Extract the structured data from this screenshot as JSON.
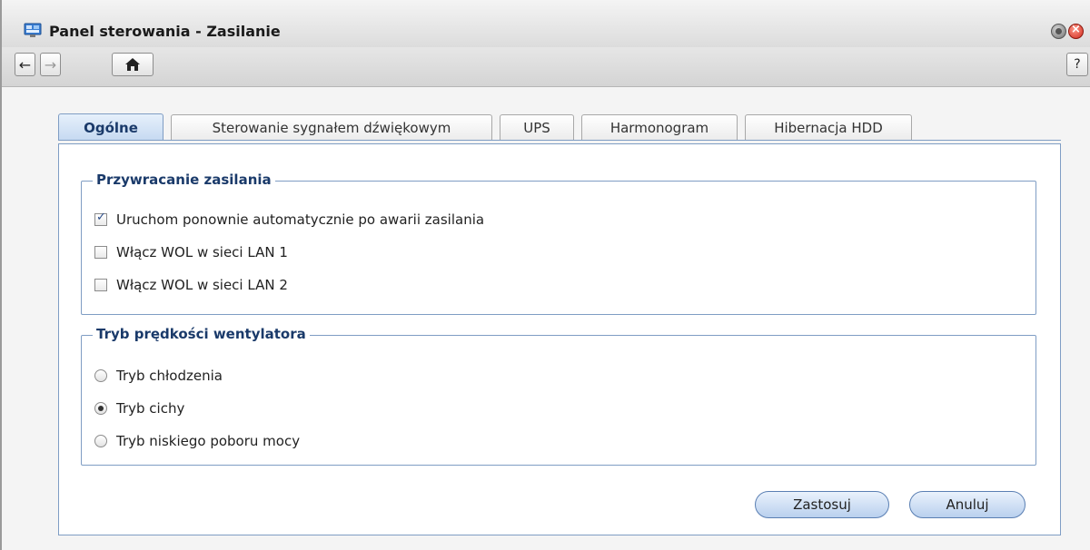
{
  "window": {
    "title": "Panel sterowania - Zasilanie",
    "app_icon": "control-panel-icon"
  },
  "toolbar": {
    "back_icon": "←",
    "forward_icon": "→",
    "home_icon": "⌂",
    "help_label": "?"
  },
  "tabs": [
    {
      "label": "Ogólne",
      "active": true
    },
    {
      "label": "Sterowanie sygnałem dźwiękowym",
      "active": false
    },
    {
      "label": "UPS",
      "active": false
    },
    {
      "label": "Harmonogram",
      "active": false
    },
    {
      "label": "Hibernacja HDD",
      "active": false
    }
  ],
  "power_recovery": {
    "legend": "Przywracanie zasilania",
    "options": [
      {
        "label": "Uruchom ponownie automatycznie po awarii zasilania",
        "checked": true
      },
      {
        "label": "Włącz WOL w sieci LAN 1",
        "checked": false
      },
      {
        "label": "Włącz WOL w sieci LAN 2",
        "checked": false
      }
    ]
  },
  "fan_mode": {
    "legend": "Tryb prędkości wentylatora",
    "options": [
      {
        "label": "Tryb chłodzenia",
        "selected": false
      },
      {
        "label": "Tryb cichy",
        "selected": true
      },
      {
        "label": "Tryb niskiego poboru mocy",
        "selected": false
      }
    ]
  },
  "actions": {
    "apply_label": "Zastosuj",
    "cancel_label": "Anuluj"
  },
  "colors": {
    "accent": "#7f9dc4",
    "legend_text": "#1a3a6a",
    "close_button": "#d0281c"
  }
}
